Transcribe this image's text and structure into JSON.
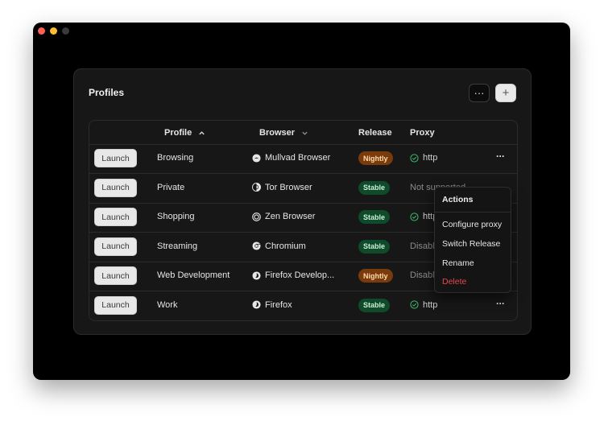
{
  "card": {
    "title": "Profiles",
    "more_label": "···",
    "add_label": "+"
  },
  "table": {
    "columns": {
      "profile": "Profile",
      "browser": "Browser",
      "release": "Release",
      "proxy": "Proxy"
    },
    "rows": [
      {
        "launch": "Launch",
        "name": "Browsing",
        "browser": "Mullvad Browser",
        "browser_icon": "mullvad-icon",
        "release": "Nightly",
        "release_kind": "nightly",
        "proxy": "http",
        "proxy_status": "ok"
      },
      {
        "launch": "Launch",
        "name": "Private",
        "browser": "Tor Browser",
        "browser_icon": "tor-icon",
        "release": "Stable",
        "release_kind": "stable",
        "proxy": "Not supported",
        "proxy_status": "muted"
      },
      {
        "launch": "Launch",
        "name": "Shopping",
        "browser": "Zen Browser",
        "browser_icon": "zen-icon",
        "release": "Stable",
        "release_kind": "stable",
        "proxy": "http",
        "proxy_status": "ok"
      },
      {
        "launch": "Launch",
        "name": "Streaming",
        "browser": "Chromium",
        "browser_icon": "chromium-icon",
        "release": "Stable",
        "release_kind": "stable",
        "proxy": "Disabled",
        "proxy_status": "muted"
      },
      {
        "launch": "Launch",
        "name": "Web Development",
        "browser": "Firefox Develop...",
        "browser_icon": "firefox-icon",
        "release": "Nightly",
        "release_kind": "nightly",
        "proxy": "Disabled",
        "proxy_status": "muted"
      },
      {
        "launch": "Launch",
        "name": "Work",
        "browser": "Firefox",
        "browser_icon": "firefox-icon",
        "release": "Stable",
        "release_kind": "stable",
        "proxy": "http",
        "proxy_status": "ok"
      }
    ]
  },
  "menu": {
    "title": "Actions",
    "items": [
      "Configure proxy",
      "Switch Release",
      "Rename",
      "Delete"
    ]
  },
  "colors": {
    "nightly": "#7a3b0c",
    "stable": "#0f4a2a",
    "danger": "#e5484d"
  }
}
